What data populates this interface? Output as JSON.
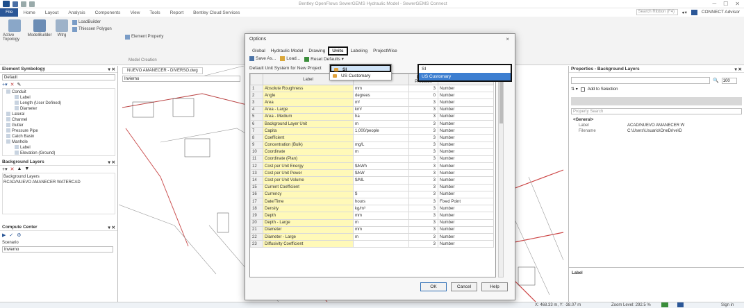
{
  "app": {
    "window_title": "Bentley OpenFlows SewerGEMS Hydraulic Model - SewerGEMS Connect",
    "quick_access": [
      "save-icon",
      "undo-icon",
      "redo-icon"
    ]
  },
  "ribbon": {
    "tabs": [
      "File",
      "Home",
      "Layout",
      "Analysis",
      "Components",
      "View",
      "Tools",
      "Report",
      "Bentley Cloud Services"
    ],
    "search_placeholder": "Search Ribbon (F4)",
    "connect_label": "CONNECT Advisor",
    "buttons": {
      "active_topology": "Active Topology",
      "model_builder": "ModelBuilder",
      "wtrg": "Wtrg",
      "load_builder": "LoadBuilder",
      "thiessen_polygon": "Thiessen Polygon",
      "element_property": "Element Property",
      "group_label": "Model Creation"
    }
  },
  "left_panel": {
    "symbology_title": "Element Symbology",
    "symbology_dropdown": "Default",
    "tree": [
      {
        "indent": 0,
        "label": "Conduit"
      },
      {
        "indent": 1,
        "label": "Label"
      },
      {
        "indent": 1,
        "label": "Length (User Defined)"
      },
      {
        "indent": 1,
        "label": "Diameter"
      },
      {
        "indent": 0,
        "label": "Lateral"
      },
      {
        "indent": 0,
        "label": "Channel"
      },
      {
        "indent": 0,
        "label": "Gutter"
      },
      {
        "indent": 0,
        "label": "Pressure Pipe"
      },
      {
        "indent": 0,
        "label": "Catch Basin"
      },
      {
        "indent": 0,
        "label": "Manhole"
      },
      {
        "indent": 1,
        "label": "Label"
      },
      {
        "indent": 1,
        "label": "Elevation (Ground)"
      }
    ],
    "background_title": "Background Layers",
    "background_items": [
      "Background Layers",
      "RCAD/NUEVO AMANECER WATERCAD"
    ],
    "compute_title": "Compute Center",
    "compute_scenario_label": "Scenario",
    "compute_scenario_value": "Invierno"
  },
  "canvas": {
    "doc_tab": "NUEVO AMANECER - DIVERSO.dwg",
    "view_dropdown": "Invierno"
  },
  "dialog": {
    "title": "Options",
    "close": "×",
    "tabs": [
      "Global",
      "Hydraulic Model",
      "Drawing",
      "Units",
      "Labeling",
      "ProjectWise"
    ],
    "selected_tab": "Units",
    "toolbar": {
      "save_as": "Save As...",
      "load": "Load...",
      "reset_defaults": "Reset Defaults"
    },
    "default_unit_label": "Default Unit System for New Project",
    "reset_menu": [
      {
        "label": "SI",
        "highlighted": true
      },
      {
        "label": "US Customary",
        "highlighted": false
      }
    ],
    "unit_dropdown": [
      {
        "label": "SI",
        "highlighted": false
      },
      {
        "label": "US Customary",
        "highlighted": true
      }
    ],
    "columns": [
      "",
      "Label",
      "Unit",
      "Display Precision",
      "Format"
    ],
    "rows": [
      [
        "1",
        "Absolute Roughness",
        "mm",
        "3",
        "Number"
      ],
      [
        "2",
        "Angle",
        "degrees",
        "0",
        "Number"
      ],
      [
        "3",
        "Area",
        "m²",
        "3",
        "Number"
      ],
      [
        "4",
        "Area - Large",
        "km²",
        "3",
        "Number"
      ],
      [
        "5",
        "Area - Medium",
        "ha",
        "3",
        "Number"
      ],
      [
        "6",
        "Background Layer Unit",
        "m",
        "3",
        "Number"
      ],
      [
        "7",
        "Capita",
        "1,000/people",
        "3",
        "Number"
      ],
      [
        "8",
        "Coefficient",
        "",
        "3",
        "Number"
      ],
      [
        "9",
        "Concentration (Bulk)",
        "mg/L",
        "3",
        "Number"
      ],
      [
        "10",
        "Coordinate",
        "m",
        "3",
        "Number"
      ],
      [
        "11",
        "Coordinate (Plan)",
        "",
        "3",
        "Number"
      ],
      [
        "12",
        "Cost per Unit Energy",
        "$/kWh",
        "3",
        "Number"
      ],
      [
        "13",
        "Cost per Unit Power",
        "$/kW",
        "3",
        "Number"
      ],
      [
        "14",
        "Cost per Unit Volume",
        "$/ML",
        "3",
        "Number"
      ],
      [
        "15",
        "Current Coefficient",
        "",
        "3",
        "Number"
      ],
      [
        "16",
        "Currency",
        "$",
        "3",
        "Number"
      ],
      [
        "17",
        "Date/Time",
        "hours",
        "3",
        "Fixed Point"
      ],
      [
        "18",
        "Density",
        "kg/m³",
        "3",
        "Number"
      ],
      [
        "19",
        "Depth",
        "mm",
        "3",
        "Number"
      ],
      [
        "20",
        "Depth - Large",
        "m",
        "3",
        "Number"
      ],
      [
        "21",
        "Diameter",
        "mm",
        "3",
        "Number"
      ],
      [
        "22",
        "Diameter - Large",
        "m",
        "3",
        "Number"
      ],
      [
        "23",
        "Diffusivity Coefficient",
        "",
        "3",
        "Number"
      ]
    ],
    "buttons": {
      "ok": "OK",
      "cancel": "Cancel",
      "help": "Help"
    }
  },
  "right_panel": {
    "title": "Properties - Background Layers",
    "zoom_value": "100",
    "add_to_selection": "Add to Selection",
    "search_placeholder": "Property Search",
    "group": "<General>",
    "props": [
      {
        "name": "Label",
        "value": "ACAD/NUEVO AMANECER W"
      },
      {
        "name": "Filename",
        "value": "C:\\Users\\Usuario\\OneDrive\\D"
      }
    ],
    "footer_label": "Label"
  },
  "status_bar": {
    "coords": "X: 468.33 m, Y: -38.07 m",
    "zoom": "Zoom Level: 292.5 %",
    "sign_in": "Sign in"
  }
}
